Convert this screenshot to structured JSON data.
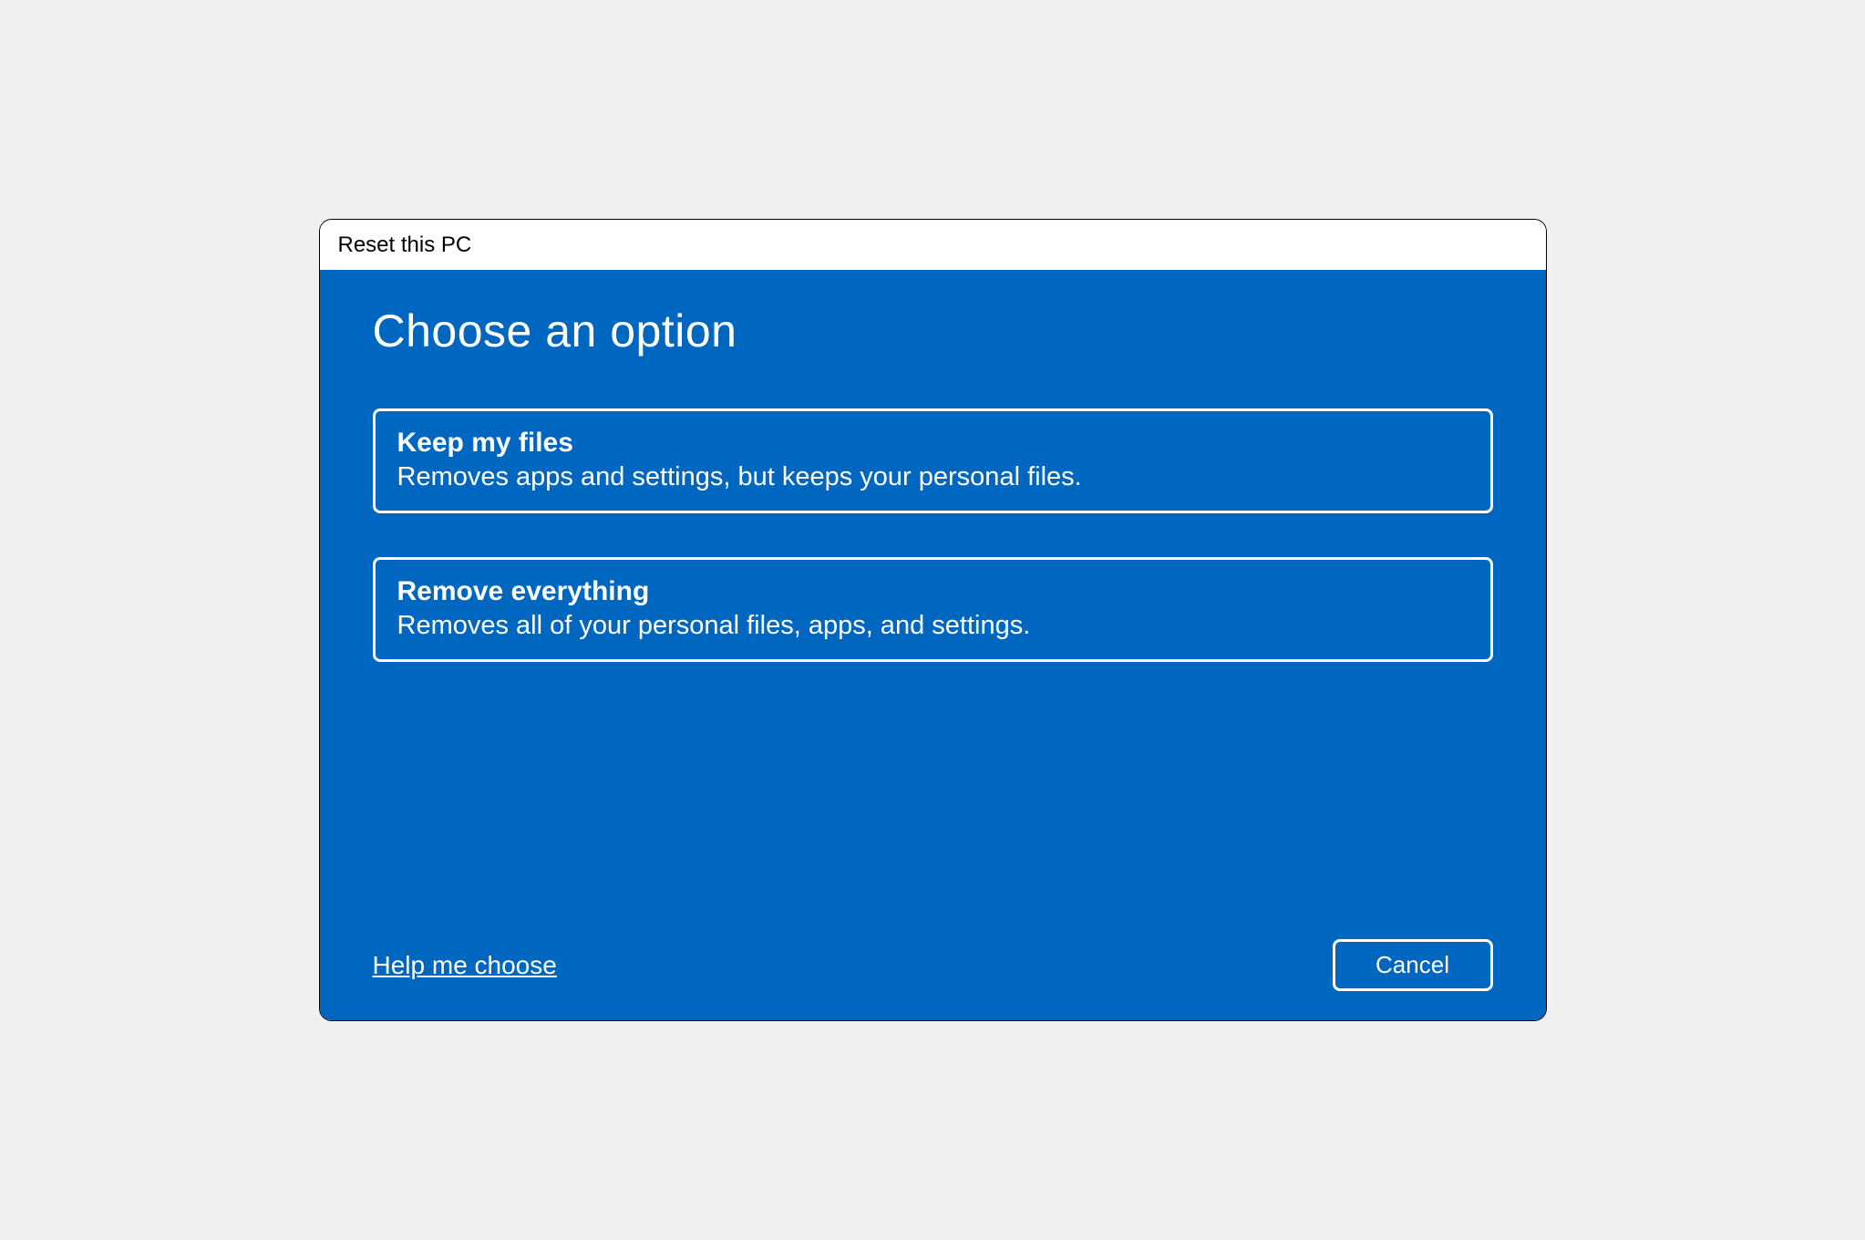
{
  "window": {
    "title": "Reset this PC"
  },
  "content": {
    "heading": "Choose an option",
    "options": [
      {
        "title": "Keep my files",
        "description": "Removes apps and settings, but keeps your personal files."
      },
      {
        "title": "Remove everything",
        "description": "Removes all of your personal files, apps, and settings."
      }
    ],
    "help_link": "Help me choose",
    "cancel_label": "Cancel"
  },
  "colors": {
    "accent": "#0067C0",
    "on_accent": "#ffffff",
    "title_text": "#000000"
  }
}
